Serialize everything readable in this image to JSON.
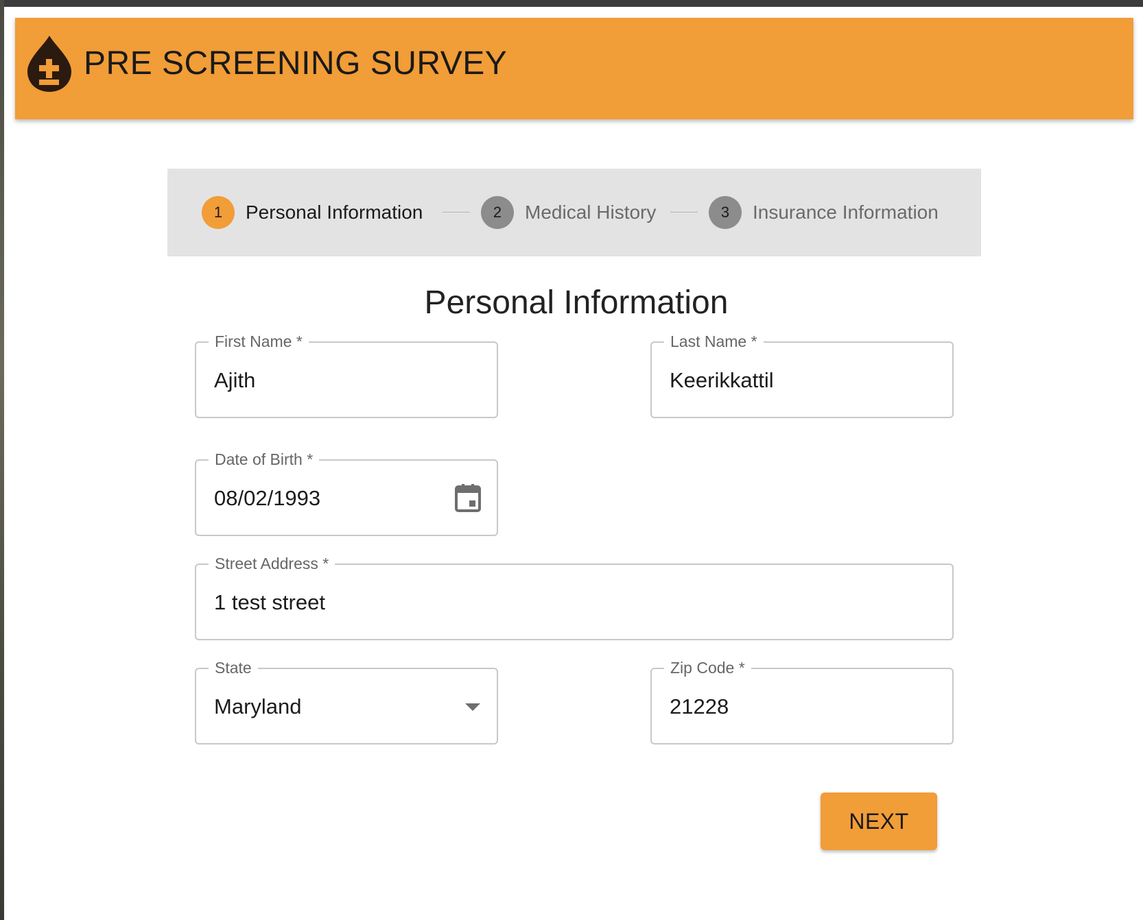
{
  "header": {
    "title": "PRE SCREENING SURVEY",
    "logo_icon": "blood-drop-plus-icon",
    "color": "#f19d38"
  },
  "stepper": {
    "steps": [
      {
        "number": "1",
        "label": "Personal Information",
        "state": "active"
      },
      {
        "number": "2",
        "label": "Medical History",
        "state": "inactive"
      },
      {
        "number": "3",
        "label": "Insurance Information",
        "state": "inactive"
      }
    ]
  },
  "form": {
    "title": "Personal Information",
    "first_name": {
      "label": "First Name *",
      "value": "Ajith"
    },
    "last_name": {
      "label": "Last Name *",
      "value": "Keerikkattil"
    },
    "dob": {
      "label": "Date of Birth *",
      "value": "08/02/1993",
      "icon": "calendar-icon"
    },
    "street": {
      "label": "Street Address *",
      "value": "1 test street"
    },
    "state": {
      "label": "State",
      "value": "Maryland",
      "icon": "dropdown-arrow-icon"
    },
    "zip": {
      "label": "Zip Code *",
      "value": "21228"
    }
  },
  "actions": {
    "next_label": "NEXT"
  }
}
